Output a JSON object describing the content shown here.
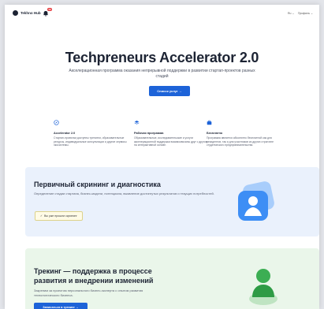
{
  "header": {
    "logo_text": "Tekhno Hub",
    "notification_count": "52",
    "language": "Ru",
    "language_chevron": "⌄",
    "profile": "Профиль ⌄"
  },
  "hero": {
    "title": "Techpreneurs Accelerator 2.0",
    "subtitle": "Акселерационная программа оказания непрерывной поддержки в развитии стартап-проектов разных стадий",
    "button_label": "Список услуг →"
  },
  "features": [
    {
      "icon": "compass-icon",
      "title": "Accelerator 2.0",
      "text": "Стартап-проектам доступны тренинги, образовательные ресурсы, индивидуальные консультации и другие сервисы экосистемы."
    },
    {
      "icon": "layers-icon",
      "title": "Рабочая программа",
      "text": "Образовательные, исследовательские и услуги акселерационной поддержки взаимосвязаны друг с другом на интерактивной основе."
    },
    {
      "icon": "briefcase-icon",
      "title": "Бесплатно",
      "text": "Программа является абсолютно бесплатной как для резидентов, так и для участников из других стран вне студенческого предпринимательства."
    }
  ],
  "card_screening": {
    "title": "Первичный скрининг и диагностика",
    "text": "Определение стадии стартапа, бизнес-модели, потенциала, выявление достигнутых результатов и текущих потребностей.",
    "badge_label": "Вы уже прошли скрининг"
  },
  "card_tracking": {
    "title_line1": "Трекинг — поддержка в процессе",
    "title_line2": "развития и внедрении изменений",
    "text": "Закрепим за проектом персонального бизнес-эксперта с опытом развития технологического бизнеса.",
    "button_label": "Записаться в трекинг →"
  },
  "colors": {
    "accent": "#1d63d8",
    "screening_bg": "#eaf1fc",
    "tracking_bg": "#eaf6ea",
    "badge_bg": "#fffbe6"
  }
}
